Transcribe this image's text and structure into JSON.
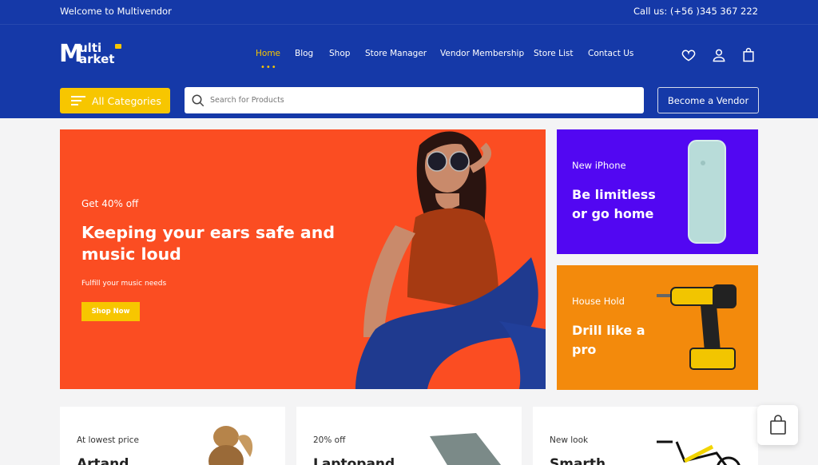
{
  "topbar": {
    "welcome": "Welcome to Multivendor",
    "call": "Call us: (+56 )345 367 222"
  },
  "logo": {
    "big_letter": "M",
    "line1": "ulti",
    "line2": "arket"
  },
  "nav": {
    "items": [
      {
        "label": "Home",
        "active": true
      },
      {
        "label": "Blog"
      },
      {
        "label": "Shop"
      },
      {
        "label": "Store Manager"
      },
      {
        "label": "Vendor Membership"
      },
      {
        "label": "Store List"
      },
      {
        "label": "Contact Us"
      }
    ],
    "active_dots": "•••"
  },
  "header_icons": [
    "heart-icon",
    "user-icon",
    "bag-icon"
  ],
  "categories": {
    "label": "All Categories"
  },
  "search": {
    "placeholder": "Search for Products"
  },
  "become_vendor": {
    "label": "Become a Vendor"
  },
  "hero": {
    "kicker": "Get 40% off",
    "title": "Keeping your ears safe and music loud",
    "subtitle": "Fulfill your music needs",
    "cta": "Shop Now"
  },
  "promos": [
    {
      "kicker": "New iPhone",
      "title": "Be limitless or go home",
      "color": "#5207f2"
    },
    {
      "kicker": "House Hold",
      "title": "Drill like a pro",
      "color": "#f38a0c"
    }
  ],
  "cards": [
    {
      "kicker": "At lowest price",
      "title": "Artand"
    },
    {
      "kicker": "20% off",
      "title": "Laptopand"
    },
    {
      "kicker": "New look",
      "title": "Smarth"
    }
  ],
  "colors": {
    "brand_blue": "#1539a8",
    "accent_yellow": "#f7c600",
    "hero_orange": "#fb4d22"
  }
}
